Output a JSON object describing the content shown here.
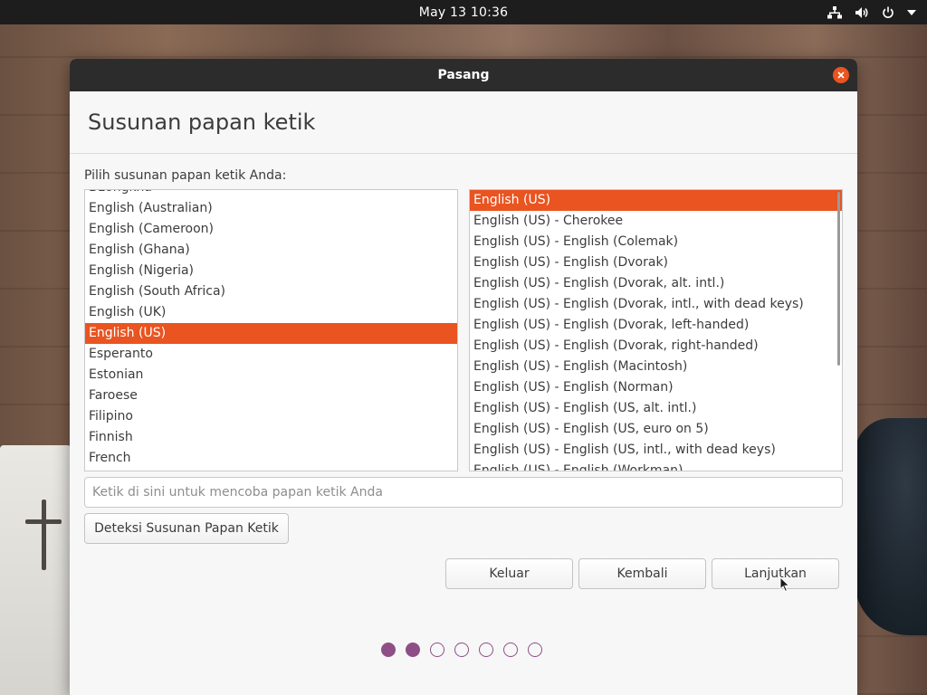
{
  "topbar": {
    "clock": "May 13  10:36",
    "icons": [
      "network-icon",
      "volume-icon",
      "power-icon",
      "menu-arrow-icon"
    ]
  },
  "window": {
    "title": "Pasang",
    "close_icon": "close-icon"
  },
  "page": {
    "title": "Susunan papan ketik",
    "prompt": "Pilih susunan papan ketik Anda:"
  },
  "layouts": {
    "items": [
      {
        "label": "Dzongkha",
        "selected": false
      },
      {
        "label": "English (Australian)",
        "selected": false
      },
      {
        "label": "English (Cameroon)",
        "selected": false
      },
      {
        "label": "English (Ghana)",
        "selected": false
      },
      {
        "label": "English (Nigeria)",
        "selected": false
      },
      {
        "label": "English (South Africa)",
        "selected": false
      },
      {
        "label": "English (UK)",
        "selected": false
      },
      {
        "label": "English (US)",
        "selected": true
      },
      {
        "label": "Esperanto",
        "selected": false
      },
      {
        "label": "Estonian",
        "selected": false
      },
      {
        "label": "Faroese",
        "selected": false
      },
      {
        "label": "Filipino",
        "selected": false
      },
      {
        "label": "Finnish",
        "selected": false
      },
      {
        "label": "French",
        "selected": false
      }
    ]
  },
  "variants": {
    "items": [
      {
        "label": "English (US)",
        "selected": true
      },
      {
        "label": "English (US) - Cherokee",
        "selected": false
      },
      {
        "label": "English (US) - English (Colemak)",
        "selected": false
      },
      {
        "label": "English (US) - English (Dvorak)",
        "selected": false
      },
      {
        "label": "English (US) - English (Dvorak, alt. intl.)",
        "selected": false
      },
      {
        "label": "English (US) - English (Dvorak, intl., with dead keys)",
        "selected": false
      },
      {
        "label": "English (US) - English (Dvorak, left-handed)",
        "selected": false
      },
      {
        "label": "English (US) - English (Dvorak, right-handed)",
        "selected": false
      },
      {
        "label": "English (US) - English (Macintosh)",
        "selected": false
      },
      {
        "label": "English (US) - English (Norman)",
        "selected": false
      },
      {
        "label": "English (US) - English (US, alt. intl.)",
        "selected": false
      },
      {
        "label": "English (US) - English (US, euro on 5)",
        "selected": false
      },
      {
        "label": "English (US) - English (US, intl., with dead keys)",
        "selected": false
      },
      {
        "label": "English (US) - English (Workman)",
        "selected": false
      }
    ]
  },
  "test_input": {
    "value": "",
    "placeholder": "Ketik di sini untuk mencoba papan ketik Anda"
  },
  "buttons": {
    "detect": "Deteksi Susunan Papan Ketik",
    "quit": "Keluar",
    "back": "Kembali",
    "continue": "Lanjutkan"
  },
  "progress": {
    "total_steps": 7,
    "completed_steps": 2
  },
  "colors": {
    "accent": "#e95420",
    "progress_dot": "#8f4f86",
    "titlebar": "#2c2c2c",
    "topbar": "#1d1d1d"
  }
}
